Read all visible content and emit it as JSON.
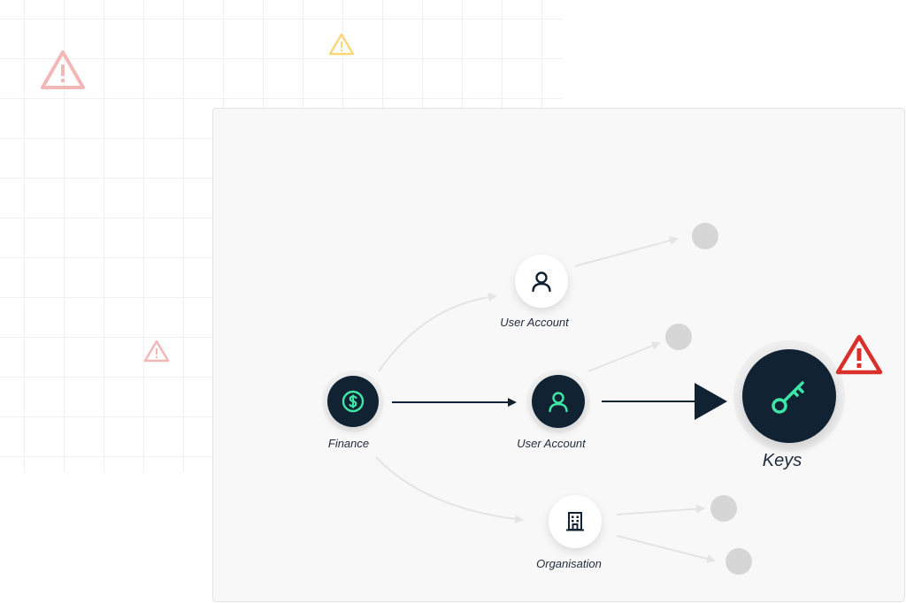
{
  "colors": {
    "dark_node": "#112233",
    "accent": "#3ee6a6",
    "alert": "#d9302c",
    "warn_faded": "#f2b8b8",
    "warn_yellow": "#fbd77a",
    "ghost": "#d6d6d6"
  },
  "nodes": {
    "finance": {
      "label": "Finance",
      "icon": "dollar-icon"
    },
    "user_account_top": {
      "label": "User Account",
      "icon": "user-icon"
    },
    "user_account_mid": {
      "label": "User Account",
      "icon": "user-icon"
    },
    "organisation": {
      "label": "Organisation",
      "icon": "building-icon"
    },
    "keys": {
      "label": "Keys",
      "icon": "key-icon",
      "alert": "warning-icon"
    }
  },
  "background_warnings": [
    "warning-icon-red-faded",
    "warning-icon-yellow",
    "warning-icon-red-faded-small"
  ]
}
